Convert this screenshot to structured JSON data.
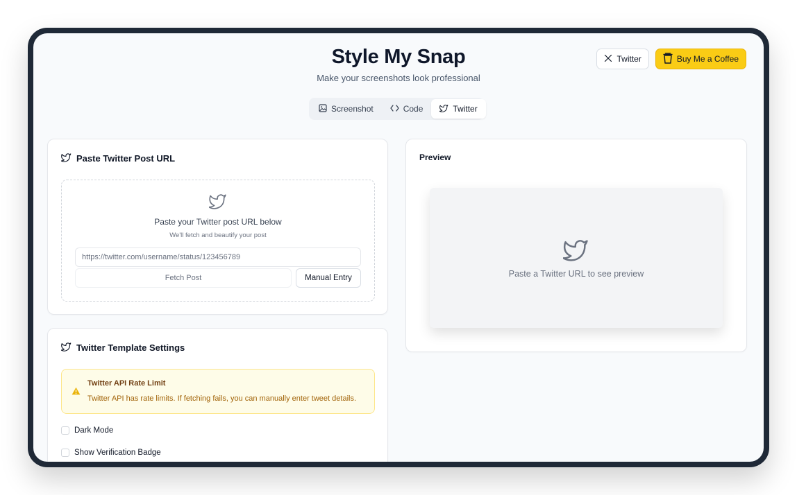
{
  "header": {
    "title": "Style My Snap",
    "subtitle": "Make your screenshots look professional",
    "twitter_button": "Twitter",
    "coffee_button": "Buy Me a Coffee"
  },
  "tabs": [
    {
      "label": "Screenshot",
      "icon": "image-icon"
    },
    {
      "label": "Code",
      "icon": "code-icon"
    },
    {
      "label": "Twitter",
      "icon": "twitter-icon",
      "active": true
    }
  ],
  "url_card": {
    "title": "Paste Twitter Post URL",
    "drop_text": "Paste your Twitter post URL below",
    "drop_subtext": "We'll fetch and beautify your post",
    "input_placeholder": "https://twitter.com/username/status/123456789",
    "fetch_button": "Fetch Post",
    "manual_button": "Manual Entry"
  },
  "settings_card": {
    "title": "Twitter Template Settings",
    "alert_title": "Twitter API Rate Limit",
    "alert_text": "Twitter API has rate limits. If fetching fails, you can manually enter tweet details.",
    "options": [
      {
        "label": "Dark Mode",
        "checked": false
      },
      {
        "label": "Show Verification Badge",
        "checked": false
      }
    ]
  },
  "preview": {
    "title": "Preview",
    "placeholder": "Paste a Twitter URL to see preview"
  },
  "colors": {
    "frame": "#1f2937",
    "background": "#f8fafc",
    "coffee": "#facc15",
    "alert_bg": "#fefce8"
  }
}
